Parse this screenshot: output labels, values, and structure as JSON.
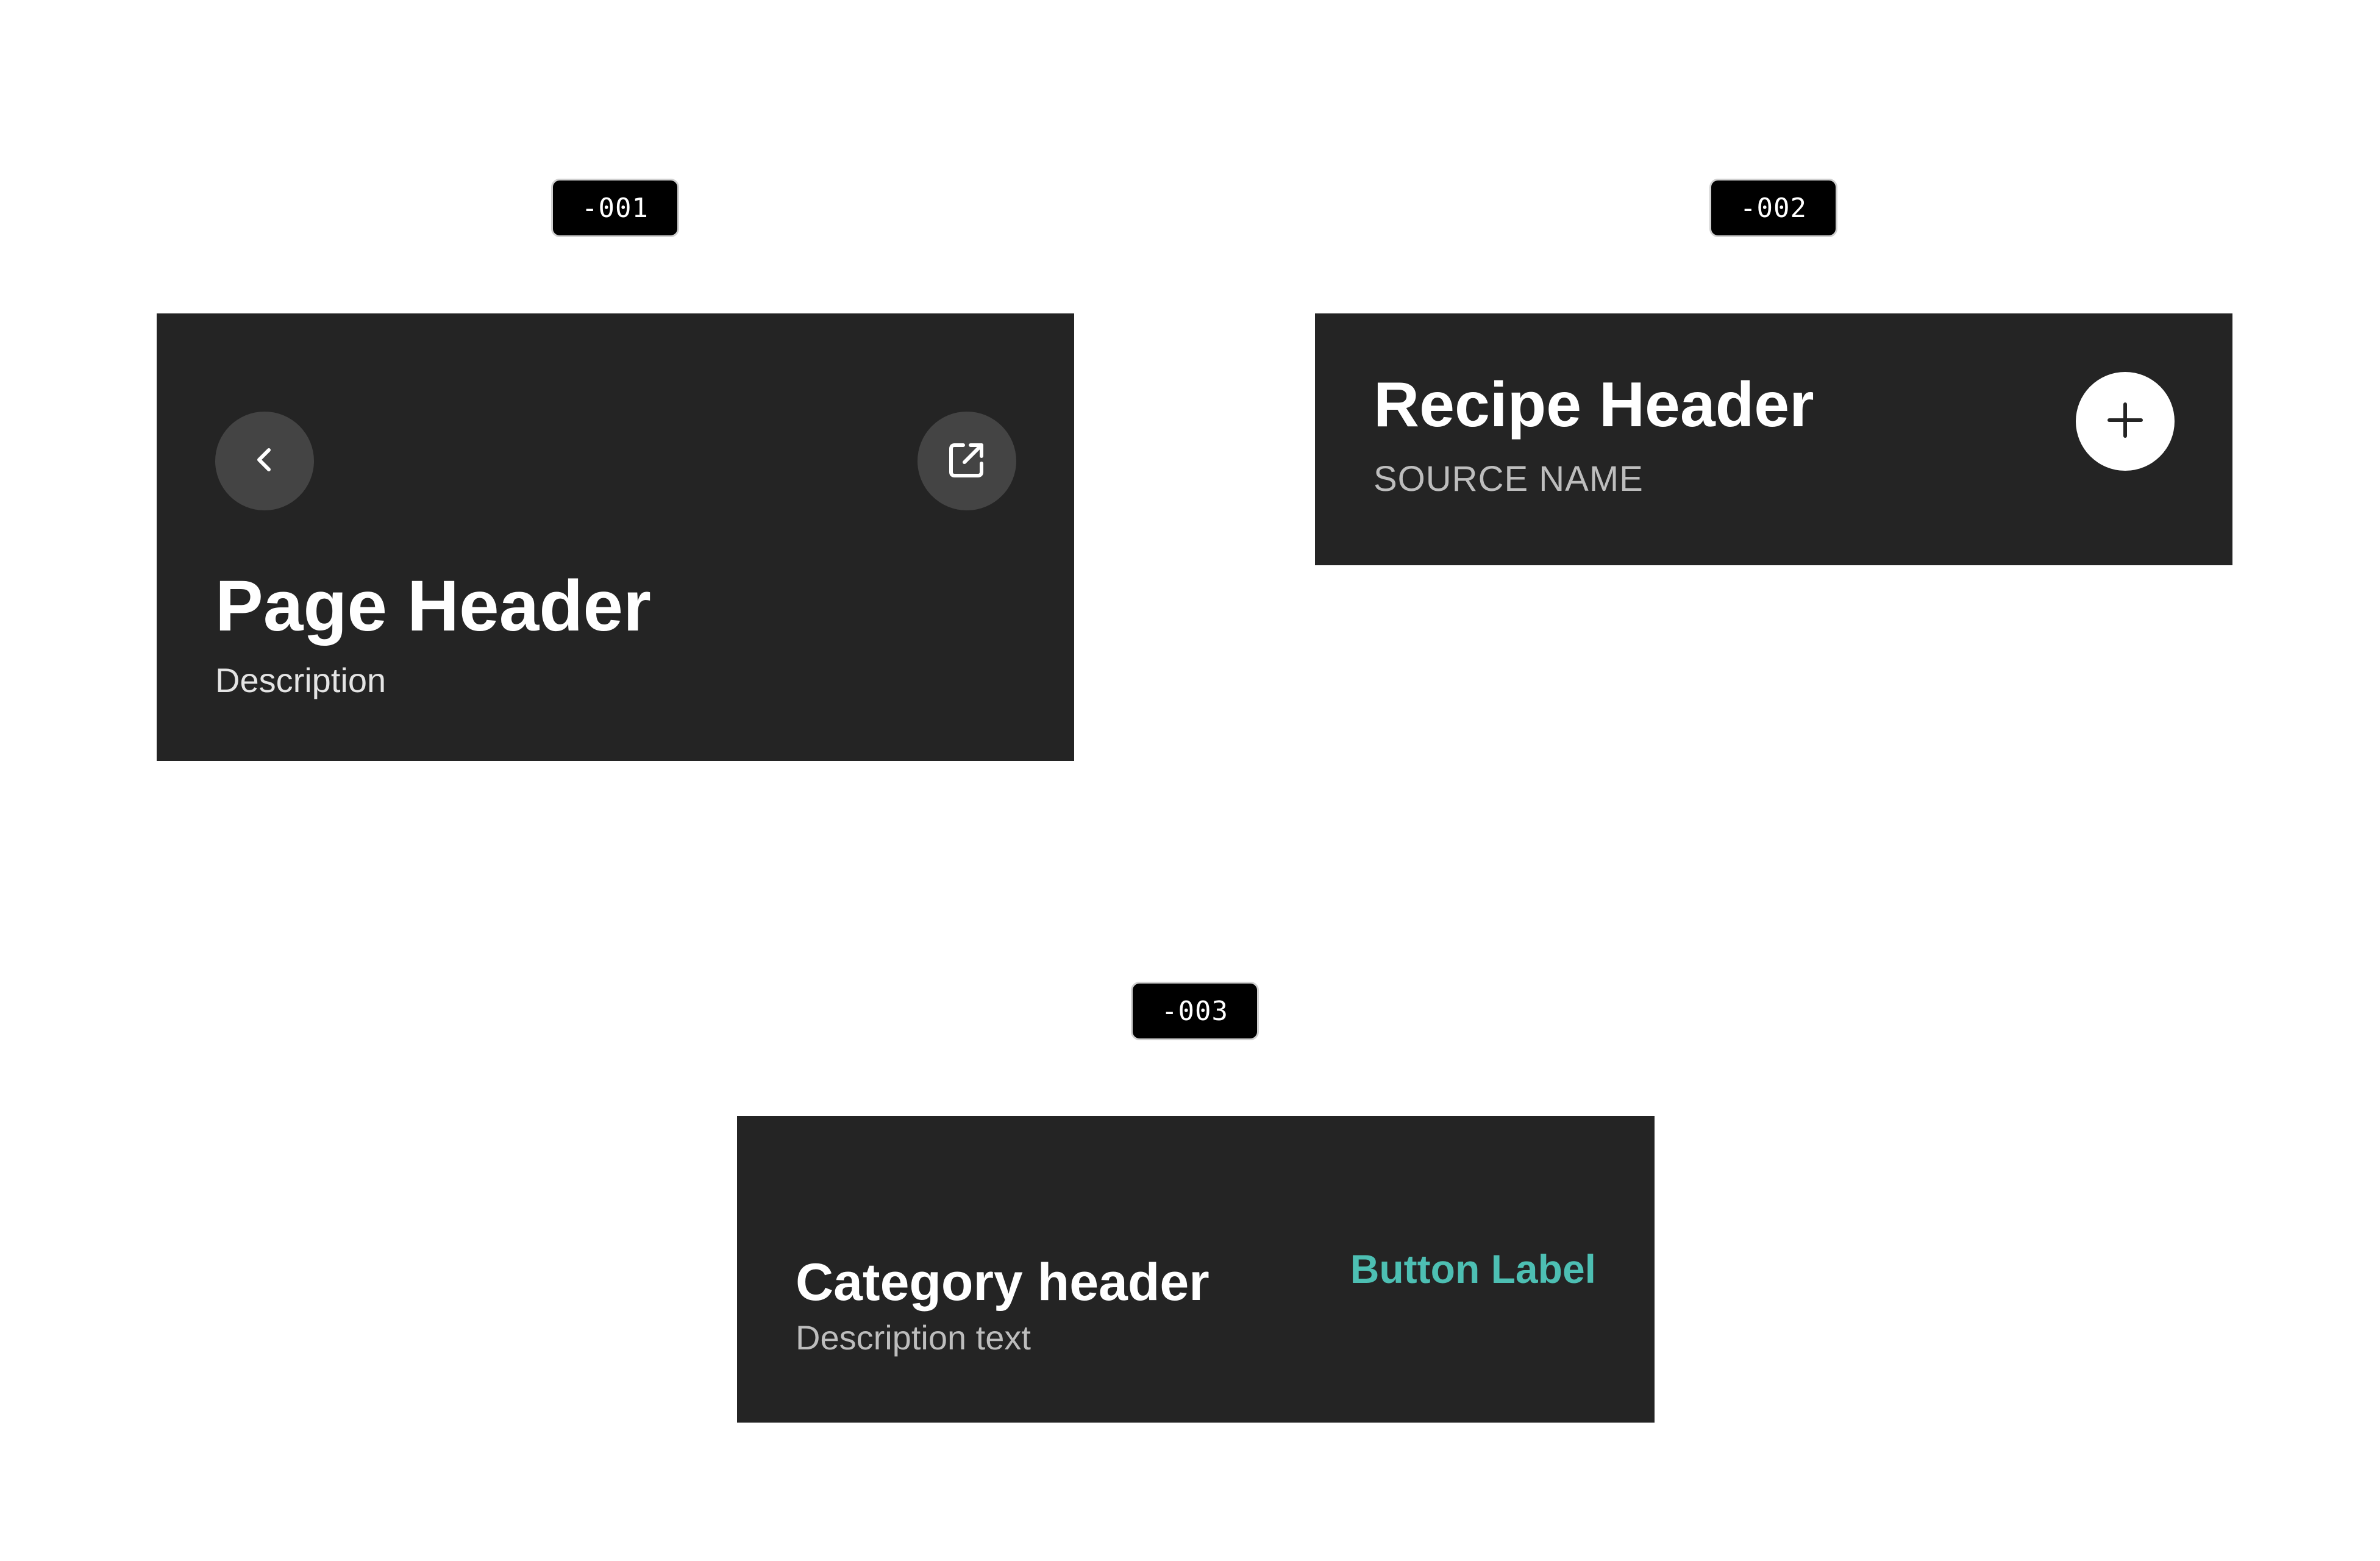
{
  "variants": [
    {
      "tag": "-001",
      "title": "Page Header",
      "description": "Description",
      "back_icon": "chevron-left-icon",
      "share_icon": "external-link-icon"
    },
    {
      "tag": "-002",
      "title": "Recipe Header",
      "source_name": "SOURCE NAME",
      "add_icon": "plus-icon"
    },
    {
      "tag": "-003",
      "title": "Category header",
      "description": "Description text",
      "button_label": "Button Label"
    }
  ],
  "colors": {
    "page_background": "#ffffff",
    "panel_background": "#242424",
    "icon_button_background": "#444444",
    "accent": "#4dbfb3",
    "tag_background": "#000000"
  }
}
